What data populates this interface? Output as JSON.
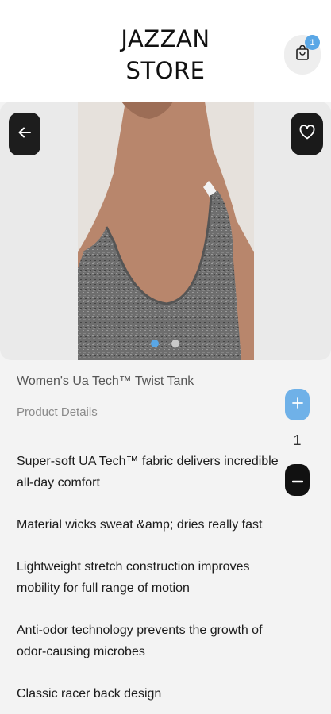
{
  "header": {
    "title_line1": "JAZZAN",
    "title_line2": "STORE",
    "cart_badge": "1",
    "cart_icon": "shopping-bag-icon"
  },
  "hero": {
    "back_icon": "arrow-left-icon",
    "favorite_icon": "heart-icon",
    "carousel_count": 2,
    "carousel_active": 1
  },
  "product": {
    "name": "Women's Ua Tech™ Twist Tank",
    "details_label": "Product Details",
    "quantity": "1",
    "features": [
      "Super-soft UA Tech™ fabric delivers incredible all-day comfort",
      "Material wicks sweat &amp; dries really fast",
      "Lightweight stretch construction improves mobility for full range of motion",
      "Anti-odor technology prevents the growth of odor-causing microbes",
      "Classic racer back design"
    ]
  },
  "colors": {
    "accent": "#5aa7e6",
    "dark": "#1a1a1a",
    "background": "#f3f3f3"
  }
}
